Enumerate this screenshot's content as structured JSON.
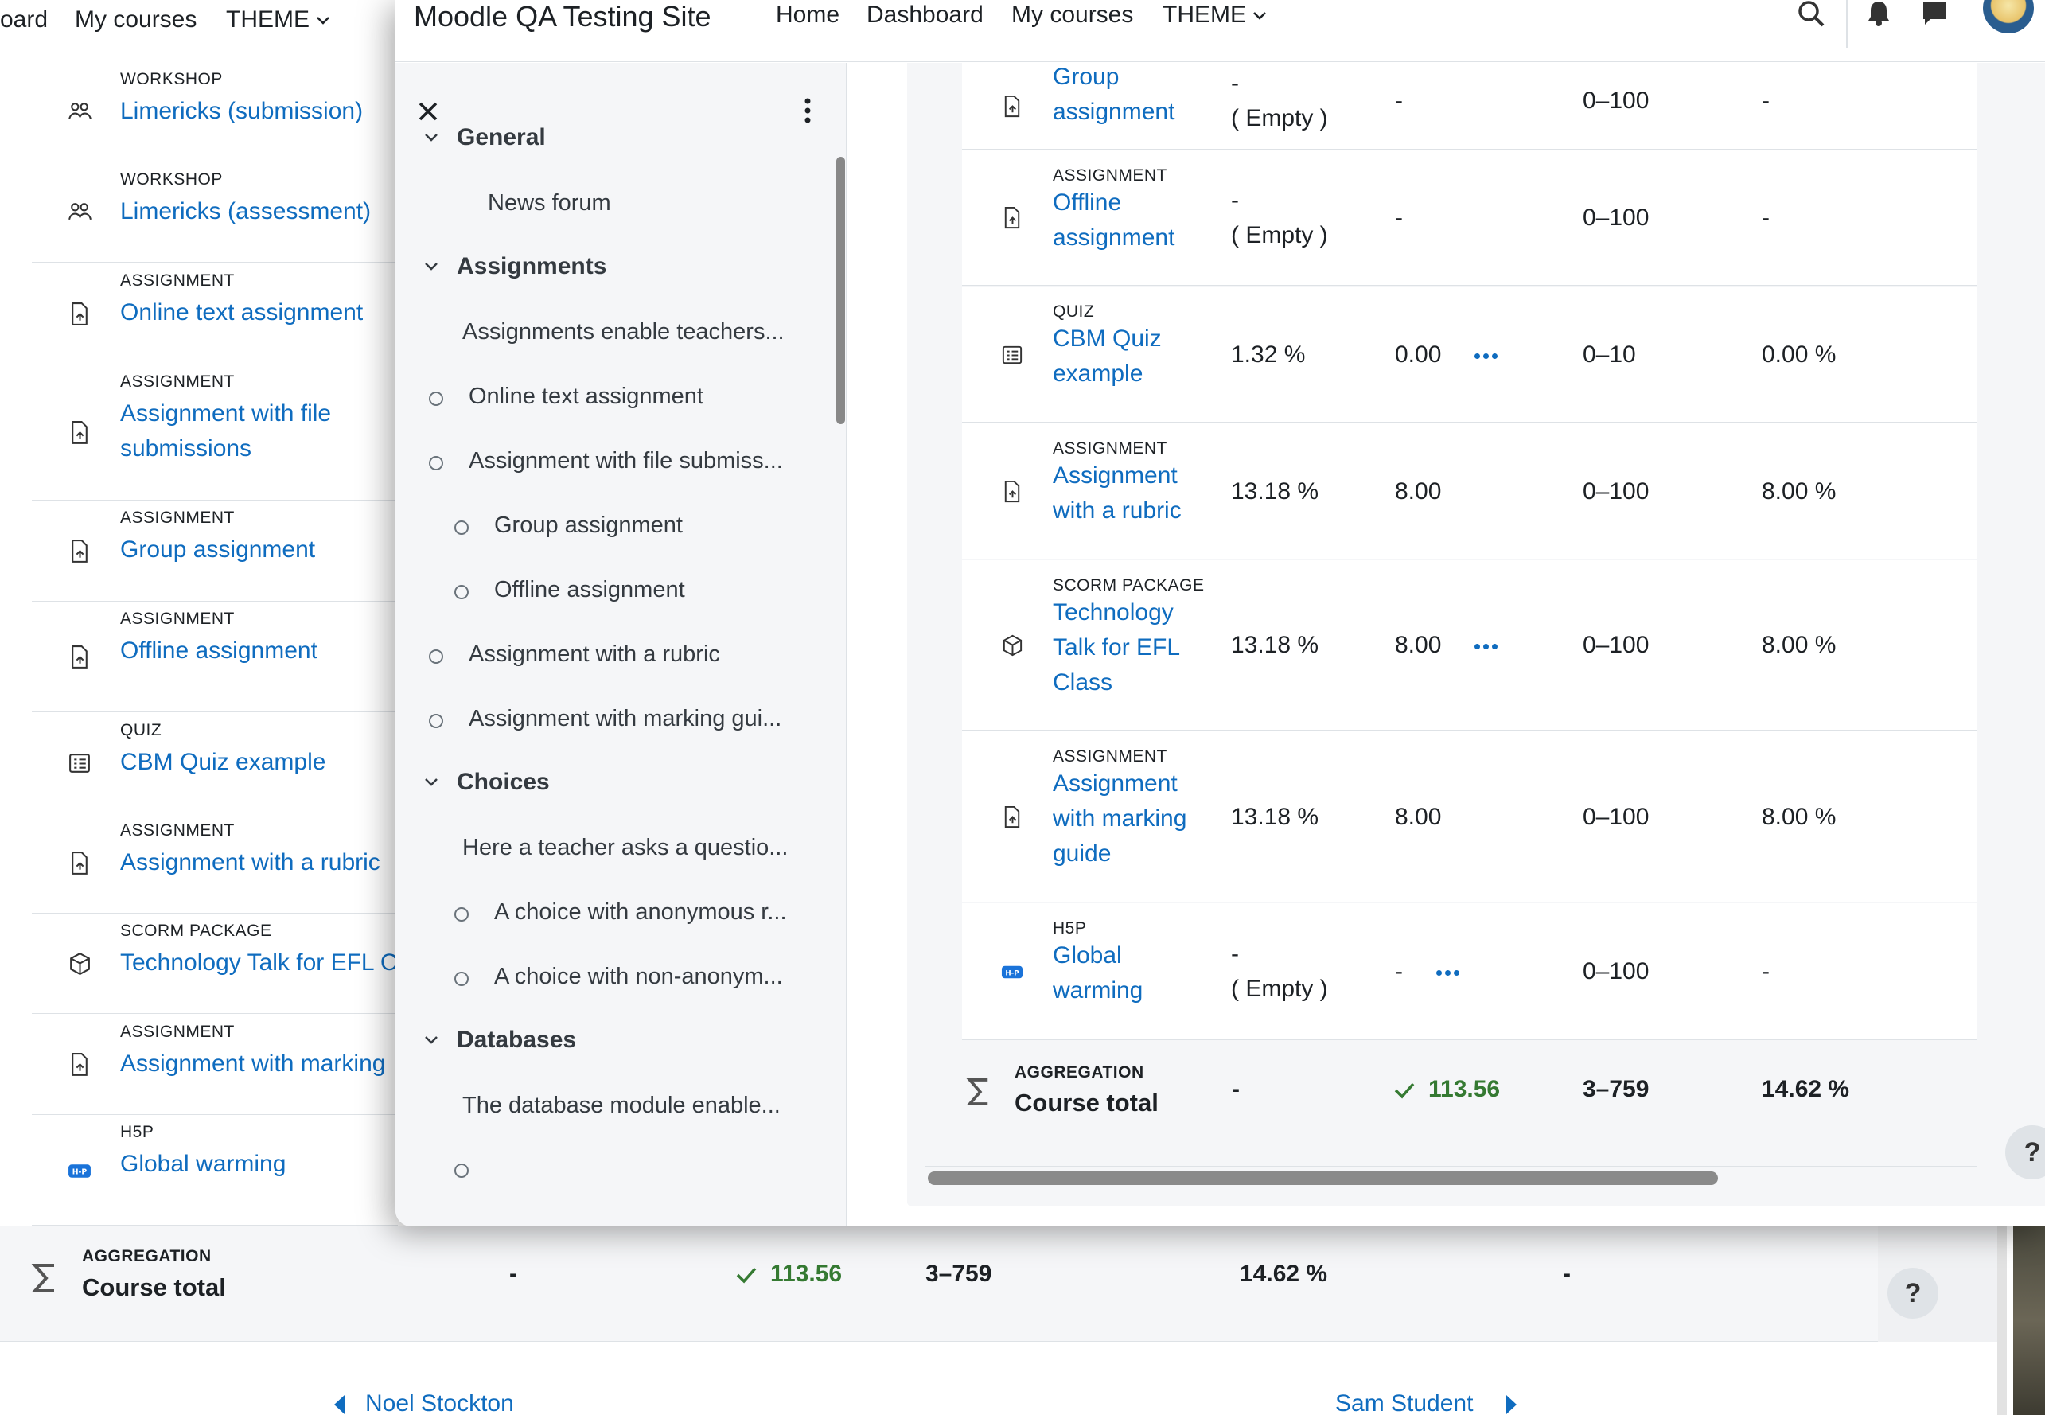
{
  "background": {
    "nav": {
      "dashboard_partial": "oard",
      "my_courses": "My courses",
      "theme": "THEME"
    },
    "activities": [
      {
        "type": "WORKSHOP",
        "name": "Limericks (submission)",
        "icon": "workshop-icon"
      },
      {
        "type": "WORKSHOP",
        "name": "Limericks (assessment)",
        "icon": "workshop-icon"
      },
      {
        "type": "ASSIGNMENT",
        "name": "Online text assignment",
        "icon": "assignment-icon"
      },
      {
        "type": "ASSIGNMENT",
        "name": "Assignment with file",
        "name2": "submissions",
        "icon": "assignment-icon"
      },
      {
        "type": "ASSIGNMENT",
        "name": "Group assignment",
        "icon": "assignment-icon"
      },
      {
        "type": "ASSIGNMENT",
        "name": "Offline assignment",
        "icon": "assignment-icon"
      },
      {
        "type": "QUIZ",
        "name": "CBM Quiz example",
        "icon": "quiz-icon"
      },
      {
        "type": "ASSIGNMENT",
        "name": "Assignment with a rubric",
        "icon": "assignment-icon"
      },
      {
        "type": "SCORM PACKAGE",
        "name": "Technology Talk for EFL C",
        "icon": "scorm-icon"
      },
      {
        "type": "ASSIGNMENT",
        "name": "Assignment with marking",
        "icon": "assignment-icon"
      },
      {
        "type": "H5P",
        "name": "Global warming",
        "icon": "h5p-icon"
      }
    ],
    "total": {
      "label": "AGGREGATION",
      "name": "Course total",
      "weight": "-",
      "grade": "113.56",
      "range": "3–759",
      "percentage": "14.62 %",
      "feedback": "-"
    },
    "footer": {
      "prev_user": "Noel Stockton",
      "next_user": "Sam Student"
    },
    "help": "?"
  },
  "modal": {
    "nav": {
      "site_name": "Moodle QA Testing Site",
      "home": "Home",
      "dashboard": "Dashboard",
      "my_courses": "My courses",
      "theme": "THEME"
    },
    "drawer": {
      "sections": [
        {
          "title": "General",
          "items": [
            {
              "label": "News forum",
              "type": "plain"
            }
          ]
        },
        {
          "title": "Assignments",
          "items": [
            {
              "label": "Assignments enable teachers...",
              "type": "plain"
            },
            {
              "label": "Online text assignment",
              "type": "circle"
            },
            {
              "label": "Assignment with file submiss...",
              "type": "circle"
            },
            {
              "label": "Group assignment",
              "type": "circle-indent"
            },
            {
              "label": "Offline assignment",
              "type": "circle-indent"
            },
            {
              "label": "Assignment with a rubric",
              "type": "circle"
            },
            {
              "label": "Assignment with marking gui...",
              "type": "circle"
            }
          ]
        },
        {
          "title": "Choices",
          "items": [
            {
              "label": "Here a teacher asks a questio...",
              "type": "plain"
            },
            {
              "label": "A choice with anonymous r...",
              "type": "circle-indent"
            },
            {
              "label": "A choice with non-anonym...",
              "type": "circle-indent"
            }
          ]
        },
        {
          "title": "Databases",
          "items": [
            {
              "label": "The database module enable...",
              "type": "plain"
            }
          ]
        }
      ]
    },
    "grades": [
      {
        "type": "",
        "name": "Group\nassignment",
        "weight": "-\n( Empty )",
        "grade": "-",
        "range": "0–100",
        "percentage": "-",
        "icon": "assignment-icon",
        "menu": false
      },
      {
        "type": "ASSIGNMENT",
        "name": "Offline\nassignment",
        "weight": "-\n( Empty )",
        "grade": "-",
        "range": "0–100",
        "percentage": "-",
        "icon": "assignment-icon",
        "menu": false
      },
      {
        "type": "QUIZ",
        "name": "CBM Quiz\nexample",
        "weight": "1.32 %",
        "grade": "0.00",
        "range": "0–10",
        "percentage": "0.00 %",
        "icon": "quiz-icon",
        "menu": true
      },
      {
        "type": "ASSIGNMENT",
        "name": "Assignment\nwith a rubric",
        "weight": "13.18 %",
        "grade": "8.00",
        "range": "0–100",
        "percentage": "8.00 %",
        "icon": "assignment-icon",
        "menu": false
      },
      {
        "type": "SCORM PACKAGE",
        "name": "Technology\nTalk for EFL\nClass",
        "weight": "13.18 %",
        "grade": "8.00",
        "range": "0–100",
        "percentage": "8.00 %",
        "icon": "scorm-icon",
        "menu": true
      },
      {
        "type": "ASSIGNMENT",
        "name": "Assignment\nwith marking\nguide",
        "weight": "13.18 %",
        "grade": "8.00",
        "range": "0–100",
        "percentage": "8.00 %",
        "icon": "assignment-icon",
        "menu": false
      },
      {
        "type": "H5P",
        "name": "Global\nwarming",
        "weight": "-\n( Empty )",
        "grade": "-",
        "range": "0–100",
        "percentage": "-",
        "icon": "h5p-icon",
        "menu": true
      }
    ],
    "total": {
      "label": "AGGREGATION",
      "name": "Course total",
      "weight": "-",
      "grade": "113.56",
      "range": "3–759",
      "percentage": "14.62 %"
    },
    "help": "?"
  },
  "colors": {
    "link": "#0f6cbf",
    "success": "#357a32",
    "drawer_bg": "#f5f6f8"
  }
}
